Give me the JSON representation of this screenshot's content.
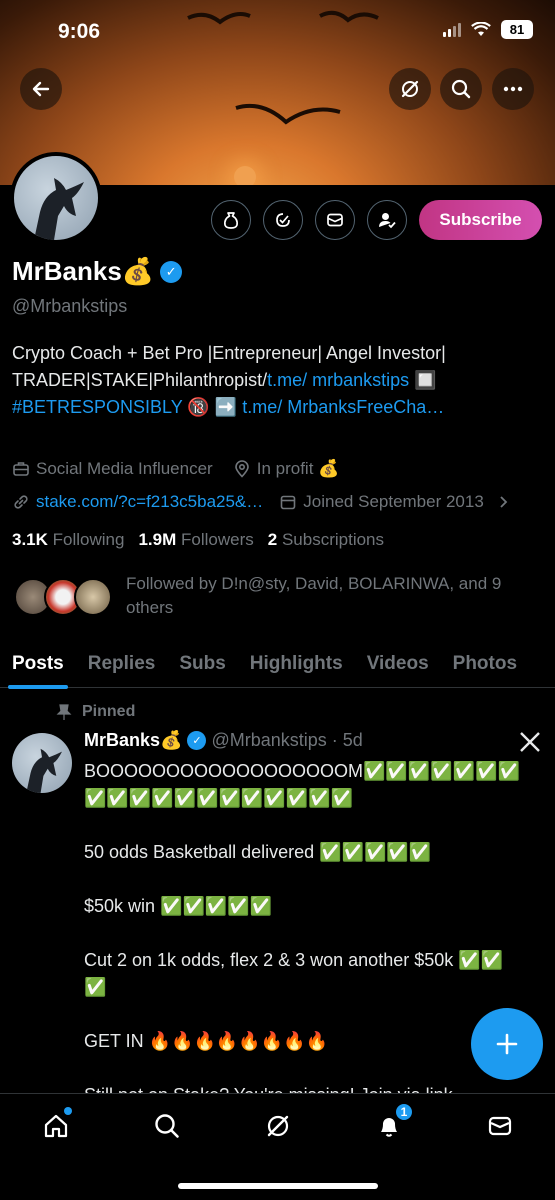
{
  "status_bar": {
    "time": "9:06",
    "battery": "81"
  },
  "profile": {
    "name": "MrBanks💰",
    "handle": "@Mrbankstips",
    "subscribe_label": "Subscribe",
    "bio_text": "Crypto Coach + Bet Pro |Entrepreneur| Angel Investor| TRADER|STAKE|Philanthropist/",
    "bio_link1": "t.me/ mrbankstips",
    "bio_mid": " 🔲 ",
    "bio_hashtag": "#BETRESPONSIBLY",
    "bio_after_hashtag": " 🔞 ➡️ ",
    "bio_link2": "t.me/ MrbanksFreeCha…",
    "category": "Social Media Influencer",
    "location": "In profit 💰",
    "website": "stake.com/?c=f213c5ba25&…",
    "joined": "Joined September 2013",
    "following_count": "3.1K",
    "following_label": "Following",
    "followers_count": "1.9M",
    "followers_label": "Followers",
    "subs_count": "2",
    "subs_label": "Subscriptions",
    "followed_by": "Followed by D!n@sty, David, BOLARINWA, and 9 others"
  },
  "tabs": [
    "Posts",
    "Replies",
    "Subs",
    "Highlights",
    "Videos",
    "Photos"
  ],
  "post": {
    "pinned_label": "Pinned",
    "author": "MrBanks💰",
    "handle": "@Mrbankstips",
    "time": "· 5d",
    "body": "BOOOOOOOOOOOOOOOOOOM✅✅✅✅✅✅✅✅✅✅✅✅✅✅✅✅✅✅✅\n\n50 odds Basketball delivered ✅✅✅✅✅\n\n$50k win ✅✅✅✅✅\n\nCut 2 on 1k odds, flex 2 & 3 won another $50k ✅✅✅\n\nGET IN 🔥🔥🔥🔥🔥🔥🔥🔥\n\nStill not on Stake? You're missing! Join via link"
  },
  "nav": {
    "notifications_count": "1"
  },
  "colors": {
    "accent": "#1d9bf0",
    "subscribe": "#c13584"
  }
}
